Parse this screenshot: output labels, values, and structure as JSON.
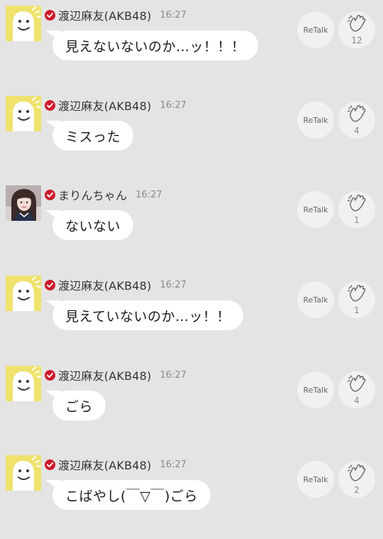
{
  "retalk_label": "ReTalk",
  "messages": [
    {
      "author": "渡辺麻友(AKB48)",
      "time": "16:27",
      "text": "見えないないのか…ッ！！！",
      "clap_count": "12",
      "avatar": "yellow-character-avatar"
    },
    {
      "author": "渡辺麻友(AKB48)",
      "time": "16:27",
      "text": "ミスった",
      "clap_count": "4",
      "avatar": "yellow-character-avatar"
    },
    {
      "author": "まりんちゃん",
      "time": "16:27",
      "text": "ないない",
      "clap_count": "1",
      "avatar": "photo-avatar"
    },
    {
      "author": "渡辺麻友(AKB48)",
      "time": "16:27",
      "text": "見えていないのか…ッ！！",
      "clap_count": "1",
      "avatar": "yellow-character-avatar"
    },
    {
      "author": "渡辺麻友(AKB48)",
      "time": "16:27",
      "text": "ごら",
      "clap_count": "4",
      "avatar": "yellow-character-avatar"
    },
    {
      "author": "渡辺麻友(AKB48)",
      "time": "16:27",
      "text": "こばやし(￣▽￣)ごら",
      "clap_count": "2",
      "avatar": "yellow-character-avatar"
    }
  ],
  "colors": {
    "background": "#e4e4e4",
    "bubble": "#ffffff",
    "verified_badge": "#d0192b",
    "avatar_yellow": "#efe26d",
    "button_bg": "#f1f1f1"
  },
  "icons": [
    "verified-badge-icon",
    "clap-icon"
  ]
}
